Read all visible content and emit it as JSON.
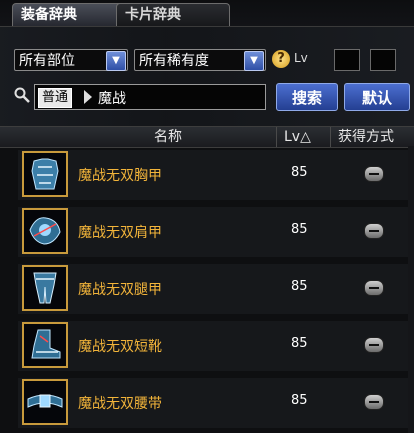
{
  "tabs": [
    {
      "label": "装备辞典",
      "active": true
    },
    {
      "label": "卡片辞典",
      "active": false
    }
  ],
  "filters": {
    "part_select": "所有部位",
    "rarity_select": "所有稀有度",
    "lv_label": "Lv",
    "lv_min": "",
    "lv_max": ""
  },
  "search": {
    "category_chip": "普通",
    "query": "魔战",
    "search_button": "搜索",
    "default_button": "默认"
  },
  "table": {
    "headers": {
      "name": "名称",
      "lv": "Lv△",
      "obtain": "获得方式"
    }
  },
  "items": [
    {
      "name": "魔战无双胸甲",
      "lv": "85",
      "icon": "chest-armor-icon"
    },
    {
      "name": "魔战无双肩甲",
      "lv": "85",
      "icon": "shoulder-armor-icon"
    },
    {
      "name": "魔战无双腿甲",
      "lv": "85",
      "icon": "leg-armor-icon"
    },
    {
      "name": "魔战无双短靴",
      "lv": "85",
      "icon": "boots-icon"
    },
    {
      "name": "魔战无双腰带",
      "lv": "85",
      "icon": "belt-icon"
    }
  ],
  "colors": {
    "item_name": "#f2b43a",
    "accent": "#3a5cc0",
    "frame": "#c89a3c"
  }
}
